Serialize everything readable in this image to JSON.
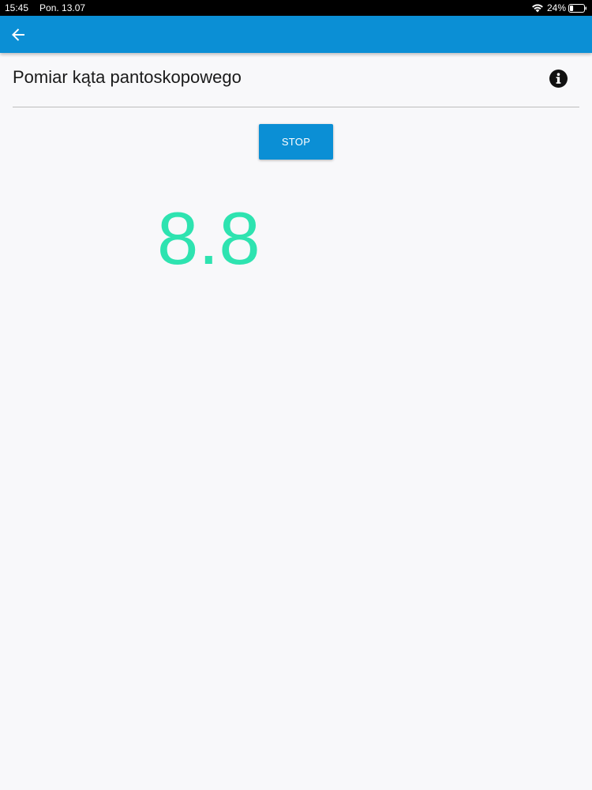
{
  "status_bar": {
    "time": "15:45",
    "date": "Pon. 13.07",
    "battery": "24%",
    "battery_level": 0.24
  },
  "app_bar": {
    "color": "#0b8fd5"
  },
  "page": {
    "title": "Pomiar kąta pantoskopowego"
  },
  "controls": {
    "stop_label": "STOP"
  },
  "measurement": {
    "value": "8.8",
    "color": "#2ee3b0"
  }
}
